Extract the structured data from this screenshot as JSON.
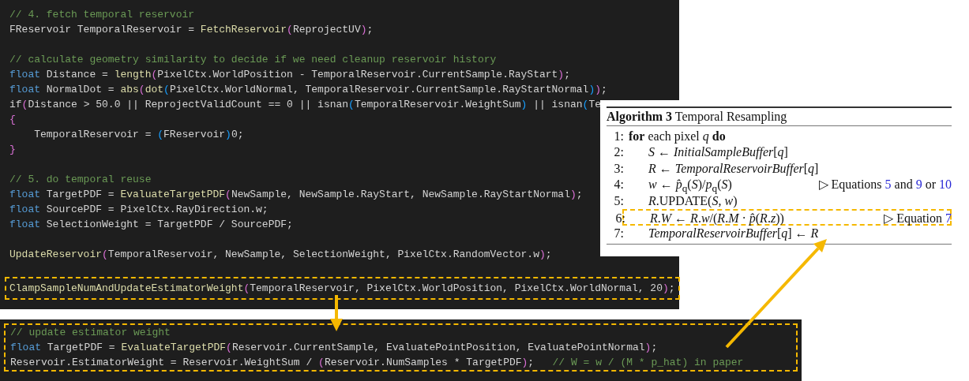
{
  "main_code": {
    "lines": [
      {
        "kind": "code",
        "segments": [
          {
            "kind": "comment",
            "text": "// 4. fetch temporal reservoir"
          }
        ]
      },
      {
        "kind": "code",
        "segments": [
          {
            "kind": "plain",
            "text": "FReservoir TemporalReservoir = "
          },
          {
            "kind": "function",
            "text": "FetchReservoir"
          },
          {
            "kind": "paren1",
            "text": "("
          },
          {
            "kind": "plain",
            "text": "ReprojectUV"
          },
          {
            "kind": "paren1",
            "text": ")"
          },
          {
            "kind": "plain",
            "text": ";"
          }
        ]
      },
      {
        "kind": "blank"
      },
      {
        "kind": "code",
        "segments": [
          {
            "kind": "comment",
            "text": "// calculate geometry similarity to decide if we need cleanup reservoir history"
          }
        ]
      },
      {
        "kind": "code",
        "segments": [
          {
            "kind": "keyword",
            "text": "float"
          },
          {
            "kind": "plain",
            "text": " Distance = "
          },
          {
            "kind": "function",
            "text": "length"
          },
          {
            "kind": "paren1",
            "text": "("
          },
          {
            "kind": "plain",
            "text": "PixelCtx.WorldPosition - TemporalReservoir.CurrentSample.RayStart"
          },
          {
            "kind": "paren1",
            "text": ")"
          },
          {
            "kind": "plain",
            "text": ";"
          }
        ]
      },
      {
        "kind": "code",
        "segments": [
          {
            "kind": "keyword",
            "text": "float"
          },
          {
            "kind": "plain",
            "text": " NormalDot = "
          },
          {
            "kind": "function",
            "text": "abs"
          },
          {
            "kind": "paren1",
            "text": "("
          },
          {
            "kind": "function",
            "text": "dot"
          },
          {
            "kind": "paren2",
            "text": "("
          },
          {
            "kind": "plain",
            "text": "PixelCtx.WorldNormal, TemporalReservoir.CurrentSample.RayStartNormal"
          },
          {
            "kind": "paren2",
            "text": ")"
          },
          {
            "kind": "paren1",
            "text": ")"
          },
          {
            "kind": "plain",
            "text": ";"
          }
        ]
      },
      {
        "kind": "code",
        "segments": [
          {
            "kind": "plain",
            "text": "if"
          },
          {
            "kind": "paren1",
            "text": "("
          },
          {
            "kind": "plain",
            "text": "Distance > 50.0 || ReprojectValidCount == 0 || isnan"
          },
          {
            "kind": "paren2",
            "text": "("
          },
          {
            "kind": "plain",
            "text": "TemporalReservoir.WeightSum"
          },
          {
            "kind": "paren2",
            "text": ")"
          },
          {
            "kind": "plain",
            "text": " || isnan"
          },
          {
            "kind": "paren2",
            "text": "("
          },
          {
            "kind": "plain",
            "text": "Te"
          }
        ]
      },
      {
        "kind": "code",
        "segments": [
          {
            "kind": "paren1",
            "text": "{"
          }
        ]
      },
      {
        "kind": "code",
        "segments": [
          {
            "kind": "plain",
            "text": "    TemporalReservoir = "
          },
          {
            "kind": "paren2",
            "text": "("
          },
          {
            "kind": "plain",
            "text": "FReservoir"
          },
          {
            "kind": "paren2",
            "text": ")"
          },
          {
            "kind": "plain",
            "text": "0;"
          }
        ]
      },
      {
        "kind": "code",
        "segments": [
          {
            "kind": "paren1",
            "text": "}"
          }
        ]
      },
      {
        "kind": "blank"
      },
      {
        "kind": "code",
        "segments": [
          {
            "kind": "comment",
            "text": "// 5. do temporal reuse"
          }
        ]
      },
      {
        "kind": "code",
        "segments": [
          {
            "kind": "keyword",
            "text": "float"
          },
          {
            "kind": "plain",
            "text": " TargetPDF = "
          },
          {
            "kind": "function",
            "text": "EvaluateTargetPDF"
          },
          {
            "kind": "paren1",
            "text": "("
          },
          {
            "kind": "plain",
            "text": "NewSample, NewSample.RayStart, NewSample.RayStartNormal"
          },
          {
            "kind": "paren1",
            "text": ")"
          },
          {
            "kind": "plain",
            "text": ";"
          }
        ]
      },
      {
        "kind": "code",
        "segments": [
          {
            "kind": "keyword",
            "text": "float"
          },
          {
            "kind": "plain",
            "text": " SourcePDF = PixelCtx.RayDirection.w;"
          }
        ]
      },
      {
        "kind": "code",
        "segments": [
          {
            "kind": "keyword",
            "text": "float"
          },
          {
            "kind": "plain",
            "text": " SelectionWeight = TargetPDF / SourcePDF;"
          }
        ]
      },
      {
        "kind": "blank"
      },
      {
        "kind": "code",
        "segments": [
          {
            "kind": "function",
            "text": "UpdateReservoir"
          },
          {
            "kind": "paren1",
            "text": "("
          },
          {
            "kind": "plain",
            "text": "TemporalReservoir, NewSample, SelectionWeight, PixelCtx.RandomVector.w"
          },
          {
            "kind": "paren1",
            "text": ")"
          },
          {
            "kind": "plain",
            "text": ";"
          }
        ]
      },
      {
        "kind": "blank"
      },
      {
        "kind": "highlighted",
        "segments": [
          {
            "kind": "function",
            "text": "ClampSampleNumAndUpdateEstimatorWeight"
          },
          {
            "kind": "paren1",
            "text": "("
          },
          {
            "kind": "plain",
            "text": "TemporalReservoir, PixelCtx.WorldPosition, PixelCtx.WorldNormal, 20"
          },
          {
            "kind": "paren1",
            "text": ")"
          },
          {
            "kind": "plain",
            "text": ";"
          }
        ]
      }
    ]
  },
  "algorithm": {
    "label": "Algorithm 3",
    "title": "Temporal Resampling",
    "steps": [
      {
        "number": "1:",
        "text": "**for** each pixel *q* **do**",
        "highlighted": false,
        "children": [
          {
            "number": "2:",
            "text": "*S* ← *InitialSampleBuffer*[*q*]",
            "highlighted": false
          },
          {
            "number": "3:",
            "text": "*R* ← *TemporalReservoirBuffer*[*q*]",
            "highlighted": false
          },
          {
            "number": "4:",
            "text": "*w* ← *p̂*$_{q}$(*S*)/*p*$_{q}$(*S*)",
            "highlighted": false,
            "note": [
              {
                "kind": "text",
                "text": "▷ Equations "
              },
              {
                "kind": "ref",
                "text": "5"
              },
              {
                "kind": "text",
                "text": " and "
              },
              {
                "kind": "ref",
                "text": "9"
              },
              {
                "kind": "text",
                "text": " or "
              },
              {
                "kind": "ref",
                "text": "10"
              }
            ]
          },
          {
            "number": "5:",
            "text": "*R*.UPDATE(*S*, *w*)",
            "highlighted": false
          },
          {
            "number": "6:",
            "text": "*R*.*W* ← *R*.*w*/(*R*.*M* · *p̂*(*R*.*z*))",
            "highlighted": true,
            "note": [
              {
                "kind": "text",
                "text": "▷ Equation "
              },
              {
                "kind": "ref",
                "text": "7"
              }
            ]
          },
          {
            "number": "7:",
            "text": "*TemporalReservoirBuffer*[*q*] ← *R*",
            "highlighted": false
          }
        ]
      }
    ]
  },
  "update_code": {
    "boxed": true,
    "lines": [
      {
        "kind": "code",
        "segments": [
          {
            "kind": "comment",
            "text": "// update estimator weight"
          }
        ]
      },
      {
        "kind": "code",
        "segments": [
          {
            "kind": "keyword",
            "text": "float"
          },
          {
            "kind": "plain",
            "text": " TargetPDF = "
          },
          {
            "kind": "function",
            "text": "EvaluateTargetPDF"
          },
          {
            "kind": "paren1",
            "text": "("
          },
          {
            "kind": "plain",
            "text": "Reservoir.CurrentSample, EvaluatePointPosition, EvaluatePointNormal"
          },
          {
            "kind": "paren1",
            "text": ")"
          },
          {
            "kind": "plain",
            "text": ";"
          }
        ]
      },
      {
        "kind": "code",
        "segments": [
          {
            "kind": "plain",
            "text": "Reservoir.EstimatorWeight = Reservoir.WeightSum / "
          },
          {
            "kind": "paren1",
            "text": "("
          },
          {
            "kind": "plain",
            "text": "Reservoir.NumSamples * TargetPDF"
          },
          {
            "kind": "paren1",
            "text": ")"
          },
          {
            "kind": "plain",
            "text": ";   "
          },
          {
            "kind": "comment",
            "text": "// W = w / (M * p_hat) in paper"
          }
        ]
      }
    ]
  }
}
